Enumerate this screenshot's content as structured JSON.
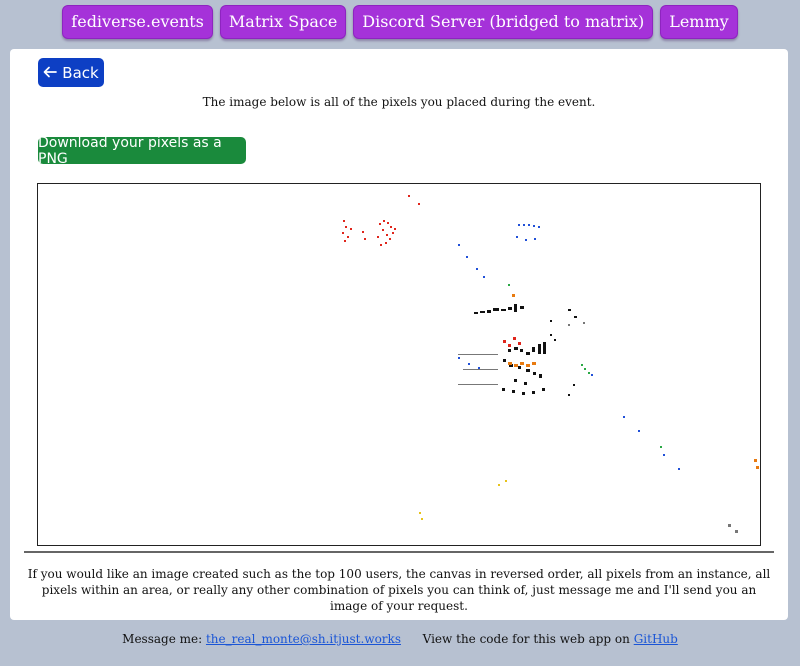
{
  "nav": [
    {
      "label": "fediverse.events"
    },
    {
      "label": "Matrix Space"
    },
    {
      "label": "Discord Server (bridged to matrix)"
    },
    {
      "label": "Lemmy"
    }
  ],
  "back_label": "Back",
  "intro_text": "The image below is all of the pixels you placed during the event.",
  "download_label": "Download your pixels as a PNG",
  "note_text": "If you would like an image created such as the top 100 users, the canvas in reversed order, all pixels from an instance, all pixels within an area, or really any other combination of pixels you can think of, just message me and I'll send you an image of your request.",
  "footer": {
    "message_prefix": "Message me:",
    "contact": "the_real_monte@sh.itjust.works",
    "code_prefix": "View the code for this web app on",
    "code_link": "GitHub"
  },
  "colors": {
    "nav_button": "#a532d9",
    "back_button": "#0d3fc4",
    "download_button": "#1a8a3c",
    "page_background": "#b7c1d1",
    "link": "#1a55d6"
  },
  "icons": {
    "back": "arrow-left-icon"
  }
}
